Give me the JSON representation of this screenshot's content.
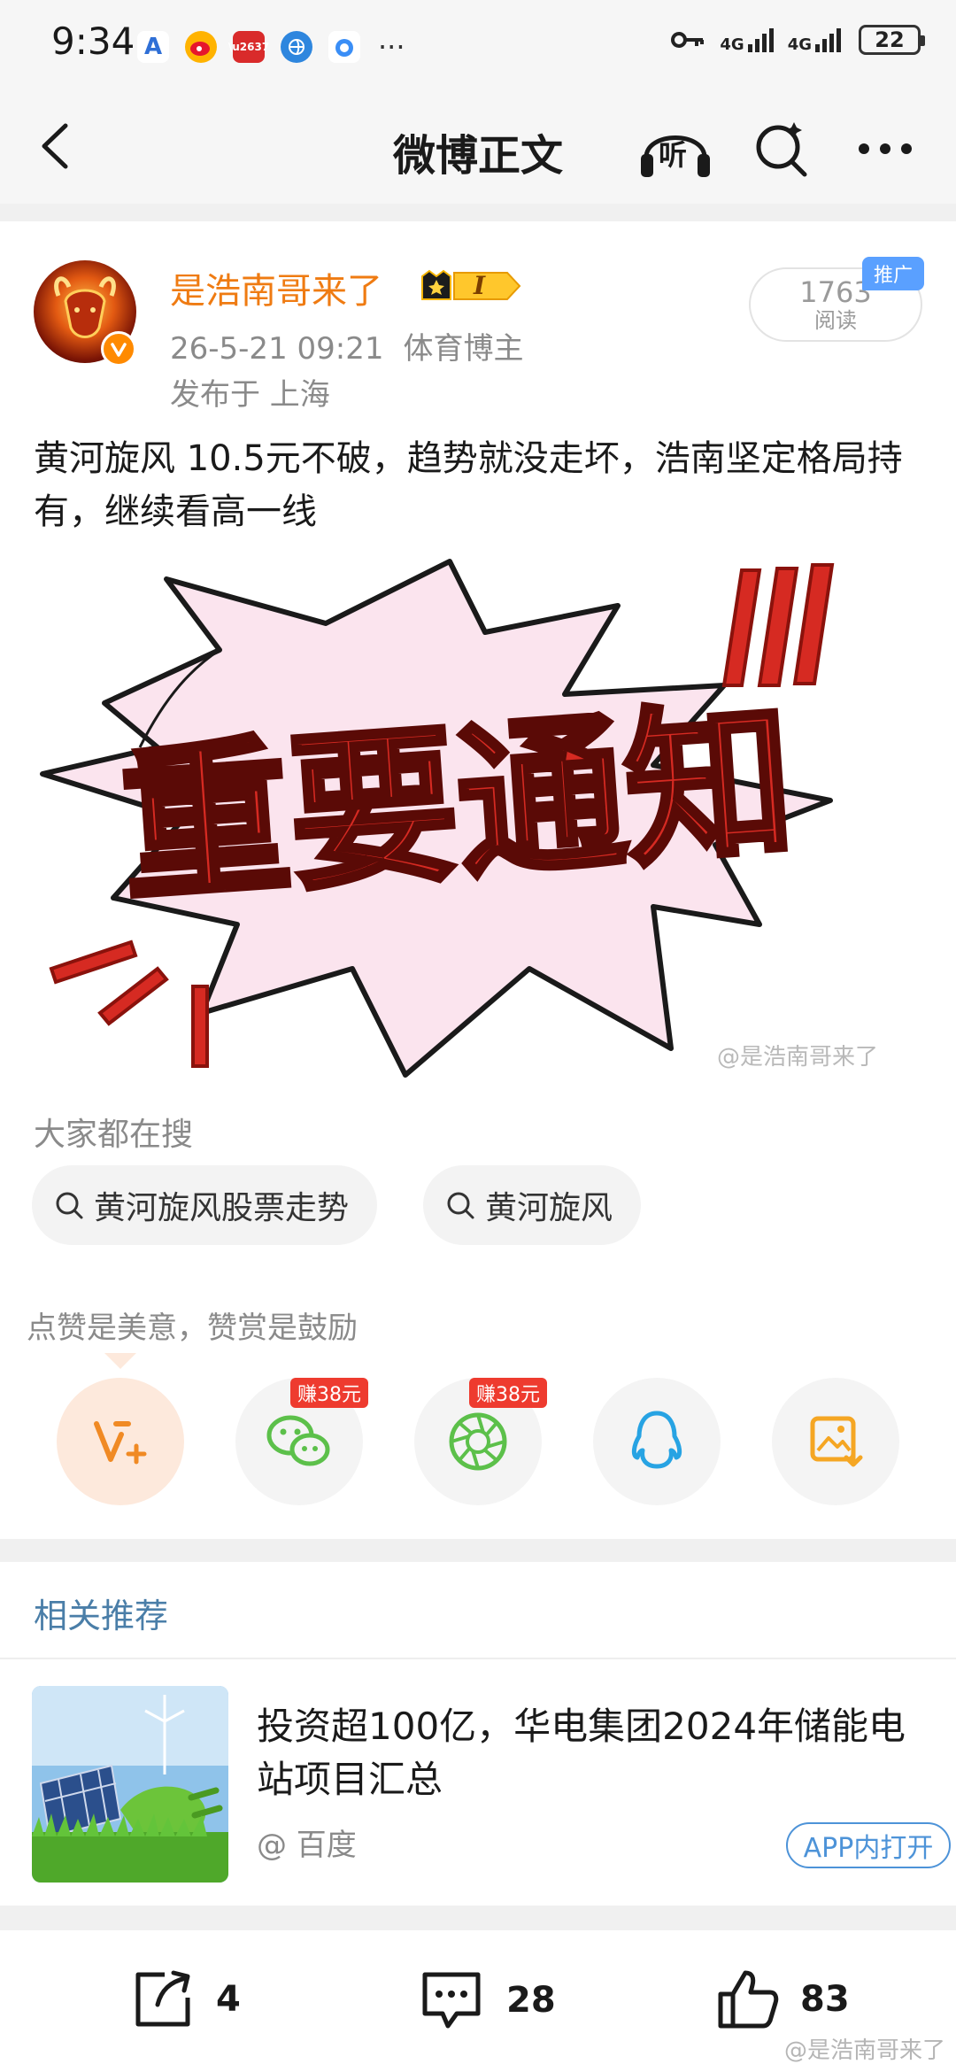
{
  "status_bar": {
    "time": "9:34",
    "more": "···",
    "network_1": "4G",
    "network_2": "4G",
    "battery": "22"
  },
  "nav": {
    "title": "微博正文",
    "listen_label": "听"
  },
  "author": {
    "name": "是浩南哥来了",
    "vip_level": "I",
    "date": "26-5-21 09:21",
    "role": "体育博主",
    "location": "发布于 上海",
    "read_count": "1763",
    "read_label": "阅读",
    "promo_tag": "推广"
  },
  "post": {
    "text": "黄河旋风 10.5元不破，趋势就没走坏，浩南坚定格局持有，继续看高一线",
    "image_text": "重要通知",
    "watermark": "@是浩南哥来了"
  },
  "searches": {
    "header": "大家都在搜",
    "items": [
      "黄河旋风股票走势",
      "黄河旋风"
    ]
  },
  "reward": {
    "hint": "点赞是美意，赞赏是鼓励",
    "earn_badge_1": "赚38元",
    "earn_badge_2": "赚38元"
  },
  "related": {
    "title": "相关推荐",
    "item_title": "投资超100亿，华电集团2024年储能电站项目汇总",
    "item_source": "@ 百度",
    "open_in_app": "APP内打开"
  },
  "bottom_bar": {
    "share_count": "4",
    "comment_count": "28",
    "like_count": "83",
    "watermark": "@是浩南哥来了"
  },
  "colors": {
    "accent_orange": "#ef7b12",
    "link_blue": "#4a7ea8",
    "alert_red": "#d62a22",
    "wechat_green": "#5cc04a",
    "qq_blue": "#27a3e3"
  }
}
